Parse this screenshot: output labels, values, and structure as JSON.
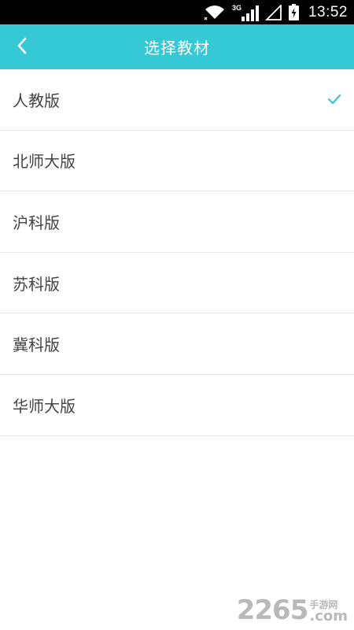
{
  "status_bar": {
    "network_type": "3G",
    "time": "13:52"
  },
  "header": {
    "title": "选择教材",
    "back_icon": "chevron-left-icon"
  },
  "textbooks": [
    {
      "label": "人教版",
      "selected": true
    },
    {
      "label": "北师大版",
      "selected": false
    },
    {
      "label": "沪科版",
      "selected": false
    },
    {
      "label": "苏科版",
      "selected": false
    },
    {
      "label": "冀科版",
      "selected": false
    },
    {
      "label": "华师大版",
      "selected": false
    }
  ],
  "watermark": {
    "number": "2265",
    "site_cn": "手游网",
    "suffix": ".com"
  },
  "colors": {
    "accent": "#35c8d5",
    "status_bar": "#000000",
    "text": "#444444",
    "divider": "#e6e6e6"
  }
}
